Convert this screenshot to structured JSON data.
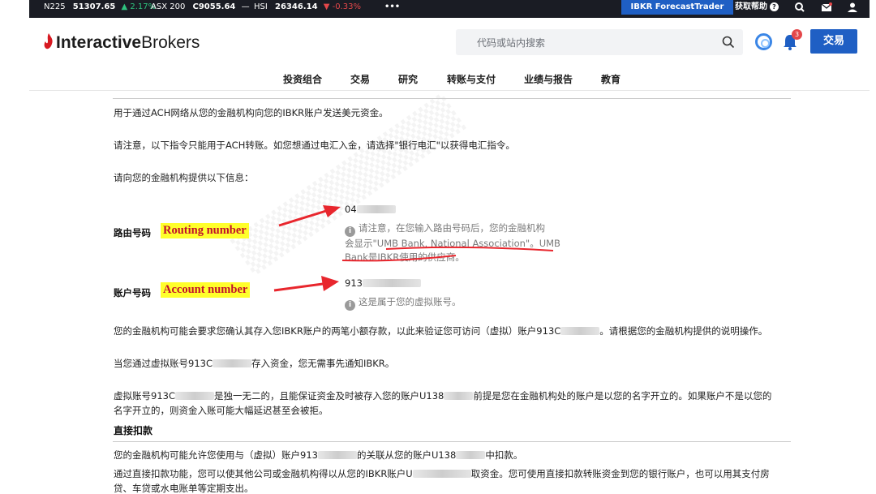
{
  "ticker": {
    "items": [
      {
        "name": "N225",
        "value": "51307.65",
        "change": "▲ 2.17%"
      },
      {
        "name": "ASX 200",
        "value": "C9055.64",
        "change": "—"
      },
      {
        "name": "HSI",
        "value": "26346.14",
        "change": "▼ -0.33%"
      }
    ],
    "more": "•••",
    "forecast_button": "IBKR ForecastTrader",
    "help_label": "获取帮助",
    "help_glyph": "?"
  },
  "header": {
    "brand_bold": "Interactive",
    "brand_regular": "Brokers",
    "search_placeholder": "代码或站内搜索",
    "notification_count": "3",
    "trade_button": "交易"
  },
  "nav": {
    "items": [
      "投资组合",
      "交易",
      "研究",
      "转账与支付",
      "业绩与报告",
      "教育"
    ]
  },
  "content": {
    "intro": "用于通过ACH网络从您的金融机构向您的IBKR账户发送美元资金。",
    "notice": "请注意，以下指令只能用于ACH转账。如您想通过电汇入金，请选择\"银行电汇\"以获得电汇指令。",
    "provide": "请向您的金融机构提供以下信息：",
    "routing": {
      "label": "路由号码",
      "callout": "Routing number",
      "value_prefix": "04",
      "info_glyph": "i",
      "note_line1": "请注意，在您输入路由号码后，您的金融机构",
      "note_line2": "会显示\"UMB Bank, National Association\"。UMB",
      "note_line3": "Bank是IBKR使用的供应商。"
    },
    "account": {
      "label": "账户号码",
      "callout": "Account number",
      "value_prefix": "913",
      "info_glyph": "i",
      "note": "这是属于您的虚拟账号。"
    },
    "verify_a": "您的金融机构可能会要求您确认其存入您IBKR账户的两笔小额存款，以此来验证您可访问（虚拟）账户913C",
    "verify_b": "。请根据您的金融机构提供的说明操作。",
    "deposit_a": "当您通过虚拟账号913C",
    "deposit_b": "存入资金，您无需事先通知IBKR。",
    "unique_a": "虚拟账号913C",
    "unique_b": "是独一无二的，且能保证资金及时被存入您的账户U138",
    "unique_c": "前提是您在金融机构处的账户是以您的名字开立的。如果账户不是以您的",
    "unique_d": "名字开立的，则资金入账可能大幅延迟甚至会被拒。",
    "direct_debit_heading": "直接扣款",
    "dd_a": "您的金融机构可能允许您使用与（虚拟）账户913",
    "dd_b": "的关联从您的账户U138",
    "dd_c": "中扣款。",
    "dd2_a": "通过直接扣款功能，您可以使其他公司或金融机构得以从您的IBKR账户U",
    "dd2_b": "取资金。您可使用直接扣款转账资金到您的银行账户，也可以用其支付房",
    "dd2_c": "贷、车贷或水电账单等定期支出。"
  },
  "colors": {
    "ticker_bg": "#1a1c24",
    "brand_blue": "#1f5fc4",
    "callout_bg": "#ffff2b",
    "callout_text": "#c0102b",
    "arrow_red": "#e8262d"
  }
}
